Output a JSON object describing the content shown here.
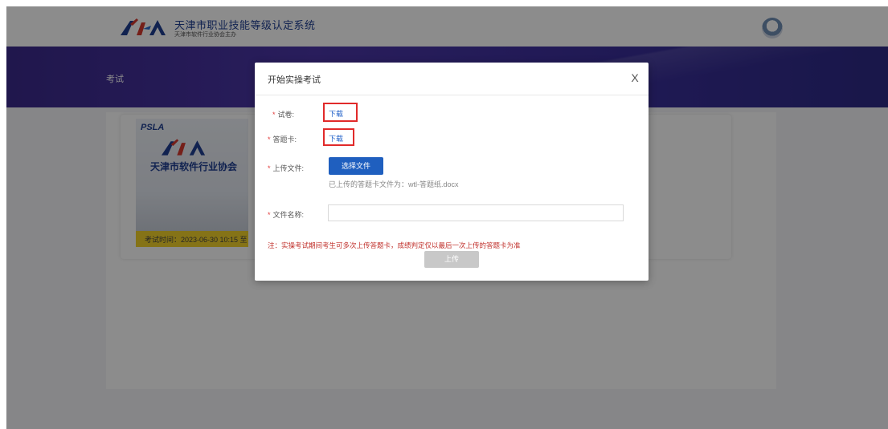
{
  "header": {
    "system_title": "天津市职业技能等级认定系统",
    "system_subtitle": "天津市软件行业协会主办"
  },
  "nav": {
    "exam_label": "考试"
  },
  "exam_card": {
    "image_brand": "PSLA",
    "image_association": "天津市软件行业协会",
    "exam_time": "考试时间：2023-06-30 10:15 至"
  },
  "modal": {
    "title": "开始实操考试",
    "close_symbol": "X",
    "required_mark": "*",
    "paper_label": "试卷:",
    "paper_link": "下载",
    "answer_card_label": "答题卡:",
    "answer_card_link": "下载",
    "upload_file_label": "上传文件:",
    "choose_file_button": "选择文件",
    "uploaded_info": "已上传的答题卡文件为：wtl-答题纸.docx",
    "file_name_label": "文件名称:",
    "file_name_value": "",
    "note": "注：实操考试期间考生可多次上传答题卡，成绩判定仅以最后一次上传的答题卡为准",
    "upload_button": "上传"
  },
  "colors": {
    "banner": "#4b36a8",
    "primary_button": "#1f5fbf",
    "link": "#2060c8",
    "required": "#e23a3a",
    "note": "#c0302b",
    "highlight_box": "#e12a2a",
    "disabled_button": "#c8c8c8"
  },
  "icons": {
    "close": "close-icon",
    "logo": "tla-logo",
    "avatar": "user-avatar-icon"
  }
}
